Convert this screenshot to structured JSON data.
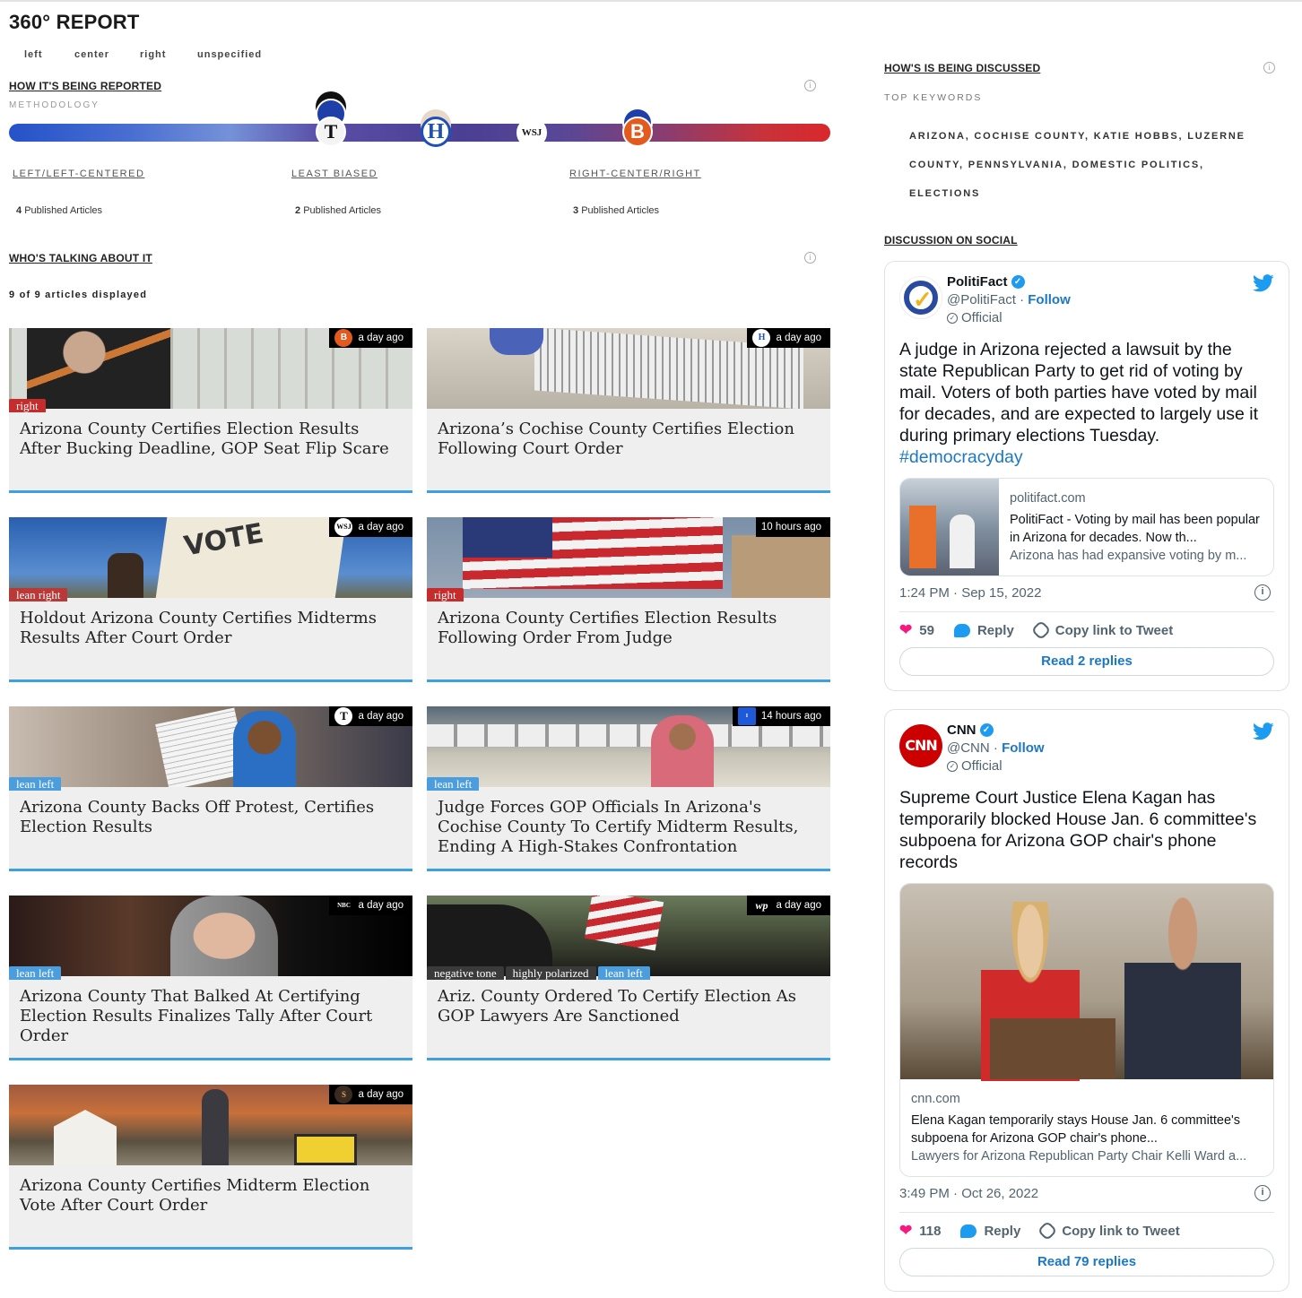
{
  "title": "360° REPORT",
  "legend": [
    "left",
    "center",
    "right",
    "unspecified"
  ],
  "reporting": {
    "heading": "HOW IT'S BEING REPORTED",
    "methodology": "METHODOLOGY",
    "buckets": [
      {
        "label": "LEFT/LEFT-CENTERED",
        "count": "4",
        "suffix": "Published Articles"
      },
      {
        "label": "LEAST BIASED",
        "count": "2",
        "suffix": "Published Articles"
      },
      {
        "label": "RIGHT-CENTER/RIGHT",
        "count": "3",
        "suffix": "Published Articles"
      }
    ],
    "source_logos": [
      "T",
      "H",
      "WSJ",
      "B"
    ]
  },
  "talking": {
    "heading": "WHO'S TALKING ABOUT IT",
    "count_line": "9 of 9 articles displayed"
  },
  "articles": [
    {
      "time": "a day ago",
      "source_icon": "B",
      "tags": [
        "right"
      ],
      "headline": "Arizona County Certifies Election Results After Bucking Deadline, GOP Seat Flip Scare"
    },
    {
      "time": "a day ago",
      "source_icon": "H",
      "tags": [],
      "headline": "Arizona’s Cochise County Certifies Election Following Court Order"
    },
    {
      "time": "a day ago",
      "source_icon": "WSJ",
      "tags": [
        "lean right"
      ],
      "headline": "Holdout Arizona County Certifies Midterms Results After Court Order"
    },
    {
      "time": "10 hours ago",
      "source_icon": "",
      "tags": [
        "right"
      ],
      "headline": "Arizona County Certifies Election Results Following Order From Judge"
    },
    {
      "time": "a day ago",
      "source_icon": "T",
      "tags": [
        "lean left"
      ],
      "headline": "Arizona County Backs Off Protest, Certifies Election Results"
    },
    {
      "time": "14 hours ago",
      "source_icon": "I",
      "tags": [
        "lean left"
      ],
      "headline": "Judge Forces GOP Officials In Arizona's Cochise County To Certify Midterm Results, Ending A High-Stakes Confrontation"
    },
    {
      "time": "a day ago",
      "source_icon": "NBC",
      "tags": [
        "lean left"
      ],
      "headline": "Arizona County That Balked At Certifying Election Results Finalizes Tally After Court Order"
    },
    {
      "time": "a day ago",
      "source_icon": "wp",
      "tags": [
        "negative tone",
        "highly polarized",
        "lean left"
      ],
      "headline": "Ariz. County Ordered To Certify Election As GOP Lawyers Are Sanctioned"
    },
    {
      "time": "a day ago",
      "source_icon": "S",
      "tags": [],
      "headline": "Arizona County Certifies Midterm Election Vote After Court Order"
    }
  ],
  "discussed": {
    "heading": "HOW'S IS BEING DISCUSSED",
    "keywords_label": "TOP KEYWORDS",
    "keywords": "ARIZONA, COCHISE COUNTY, KATIE HOBBS, LUZERNE COUNTY, PENNSYLVANIA, DOMESTIC POLITICS, ELECTIONS",
    "social_heading": "DISCUSSION ON SOCIAL"
  },
  "tweets": [
    {
      "name": "PolitiFact",
      "handle": "@PolitiFact",
      "follow": "Follow",
      "official": "Official",
      "text": "A judge in Arizona rejected a lawsuit by the state Republican Party to get rid of voting by mail. Voters of both parties have voted by mail for decades, and are expected to largely use it during primary elections Tuesday.",
      "hashtag": "#democracyday",
      "card_domain": "politifact.com",
      "card_title": "PolitiFact - Voting by mail has been popular in Arizona for decades. Now th...",
      "card_desc": "Arizona has had expansive voting by m...",
      "timestamp": "1:24 PM · Sep 15, 2022",
      "likes": "59",
      "reply": "Reply",
      "copy": "Copy link to Tweet",
      "read": "Read 2 replies"
    },
    {
      "name": "CNN",
      "handle": "@CNN",
      "follow": "Follow",
      "official": "Official",
      "text": "Supreme Court Justice Elena Kagan has temporarily blocked House Jan. 6 committee's subpoena for Arizona GOP chair's phone records",
      "card_domain": "cnn.com",
      "card_title": "Elena Kagan temporarily stays House Jan. 6 committee's subpoena for Arizona GOP chair's phone...",
      "card_desc": "Lawyers for Arizona Republican Party Chair Kelli Ward a...",
      "timestamp": "3:49 PM · Oct 26, 2022",
      "likes": "118",
      "reply": "Reply",
      "copy": "Copy link to Tweet",
      "read": "Read 79 replies"
    }
  ],
  "colors": {
    "right": "#c62c2c",
    "lean_left": "#4c9ddd",
    "card_underline": "#3fa0e0",
    "twitter_blue": "#1d9bf0"
  }
}
